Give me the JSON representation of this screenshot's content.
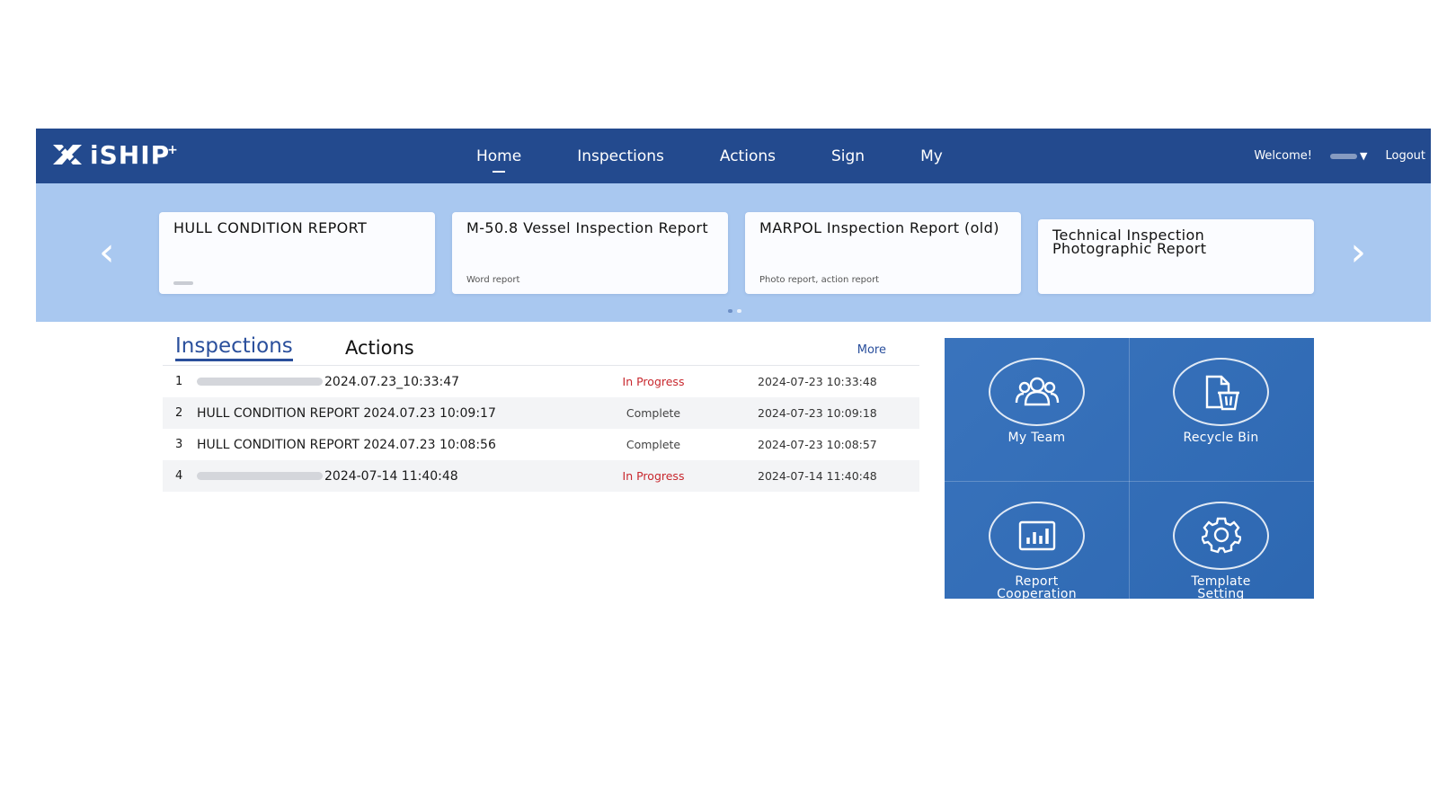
{
  "brand": {
    "name": "iSHIP",
    "plus": "+"
  },
  "nav": [
    {
      "label": "Home",
      "active": true
    },
    {
      "label": "Inspections"
    },
    {
      "label": "Actions"
    },
    {
      "label": "Sign"
    },
    {
      "label": "My"
    }
  ],
  "header": {
    "welcome": "Welcome!",
    "logout": "Logout"
  },
  "carousel": {
    "cards": [
      {
        "title": "HULL CONDITION REPORT",
        "subtitle": ""
      },
      {
        "title": "M-50.8 Vessel Inspection Report",
        "subtitle": "Word report"
      },
      {
        "title": "MARPOL Inspection Report (old)",
        "subtitle": "Photo report, action report"
      },
      {
        "title": "Technical Inspection Photographic Report",
        "subtitle": ""
      }
    ],
    "page_count": 2,
    "active_page": 1
  },
  "tabs": {
    "inspections": "Inspections",
    "actions": "Actions",
    "more": "More"
  },
  "inspections": [
    {
      "index": "1",
      "name": "2024.07.23_10:33:47",
      "name_blurred": true,
      "status": "In Progress",
      "time": "2024-07-23 10:33:48"
    },
    {
      "index": "2",
      "name": "HULL CONDITION REPORT 2024.07.23 10:09:17",
      "name_blurred": false,
      "status": "Complete",
      "time": "2024-07-23 10:09:18"
    },
    {
      "index": "3",
      "name": "HULL CONDITION REPORT 2024.07.23 10:08:56",
      "name_blurred": false,
      "status": "Complete",
      "time": "2024-07-23 10:08:57"
    },
    {
      "index": "4",
      "name": "2024-07-14 11:40:48",
      "name_blurred": true,
      "status": "In Progress",
      "time": "2024-07-14 11:40:48"
    }
  ],
  "tools": [
    {
      "label": "My Team",
      "icon": "team-icon"
    },
    {
      "label": "Recycle Bin",
      "icon": "recycle-bin-icon"
    },
    {
      "label": "Report Cooperation",
      "icon": "bar-chart-icon"
    },
    {
      "label": "Template Setting",
      "icon": "gear-icon"
    }
  ],
  "colors": {
    "header_bg": "#234a8e",
    "banner_bg": "#a9c8f0",
    "accent": "#2a4f9c",
    "in_progress": "#c8282e",
    "tools_bg": "#2f6cb9"
  }
}
